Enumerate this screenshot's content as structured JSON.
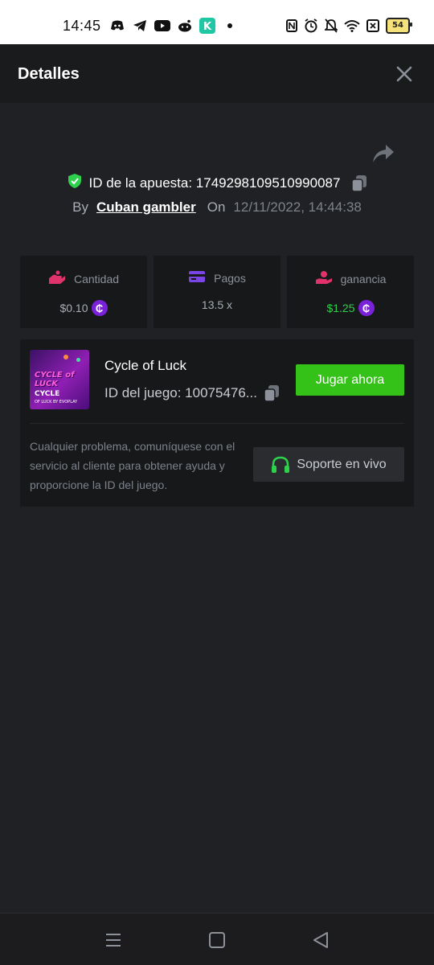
{
  "status_bar": {
    "time": "14:45",
    "left_icons": [
      "discord-icon",
      "telegram-icon",
      "youtube-icon",
      "reddit-icon",
      "app-k-icon",
      "dot-icon"
    ],
    "right_icons": [
      "nfc-icon",
      "alarm-icon",
      "bell-off-icon",
      "wifi-icon",
      "sim-x-icon"
    ],
    "battery": "54"
  },
  "header": {
    "title": "Detalles"
  },
  "bet": {
    "id_label": "ID de la apuesta: 1749298109510990087",
    "by_label": "By",
    "user": "Cuban gambler",
    "on_label": "On",
    "date": "12/11/2022, 14:44:38"
  },
  "stats": [
    {
      "label": "Cantidad",
      "value": "$0.10",
      "icon": "bet-hand-icon",
      "icon_color": "#e0336b"
    },
    {
      "label": "Pagos",
      "value": "13.5 x",
      "icon": "card-icon",
      "icon_color": "#7a44e6"
    },
    {
      "label": "ganancia",
      "value": "$1.25",
      "icon": "profit-hand-icon",
      "icon_color": "#e0336b",
      "value_color": "#2dd14b"
    }
  ],
  "coin_symbol": "₵",
  "game": {
    "name": "Cycle of Luck",
    "id_label": "ID del juego: 10075476...",
    "play_label": "Jugar ahora",
    "thumb_title": "CYCLE of LUCK",
    "thumb_subtitle": "CYCLE",
    "thumb_caption": "OF LUCK BY EVOPLAY",
    "help_text": "Cualquier problema, comuníquese con el servicio al cliente para obtener ayuda y proporcione la ID del juego.",
    "support_label": "Soporte en vivo"
  },
  "colors": {
    "accent_green": "#34c219",
    "shield_green": "#2dd14b",
    "coin_purple": "#7a22d8"
  }
}
